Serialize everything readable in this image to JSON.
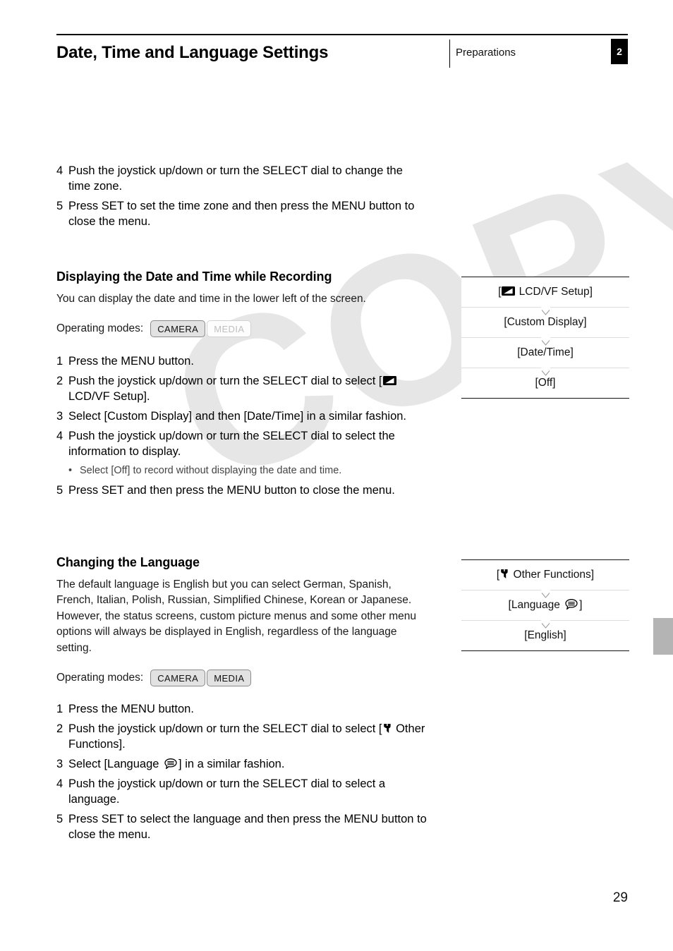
{
  "header": {
    "title": "Date, Time and Language Settings",
    "section": "Preparations",
    "chapter_number": "2"
  },
  "watermark": {
    "text": "COPY"
  },
  "top_steps": [
    {
      "num": "4",
      "text": "Push the joystick up/down or turn the SELECT dial to change the time zone."
    },
    {
      "num": "5",
      "text": "Press SET to set the time zone and then press the MENU button to close the menu."
    }
  ],
  "section_display": {
    "heading": "Displaying the Date and Time while Recording",
    "intro": "You can display the date and time in the lower left of the screen.",
    "operating_modes_label": "Operating modes:",
    "modes": [
      {
        "label": "CAMERA",
        "active": true
      },
      {
        "label": "MEDIA",
        "active": false
      }
    ],
    "steps": [
      {
        "num": "1",
        "text": "Press the MENU button."
      },
      {
        "num": "2",
        "text_before": "Push the joystick up/down or turn the SELECT dial to select [",
        "icon": "lcdvf-icon",
        "text_after": " LCD/VF Setup]."
      },
      {
        "num": "3",
        "text": "Select [Custom Display] and then [Date/Time] in a similar fashion."
      },
      {
        "num": "4",
        "text": "Push the joystick up/down or turn the SELECT dial to select the information to display."
      },
      {
        "num": "5",
        "text": "Press SET and then press the MENU button to close the menu."
      }
    ],
    "bullet": "Select [Off] to record without displaying the date and time.",
    "menu_flow": [
      {
        "prefix": "[",
        "icon": "lcdvf-icon",
        "label": " LCD/VF Setup]"
      },
      {
        "label": "[Custom Display]"
      },
      {
        "label": "[Date/Time]"
      },
      {
        "label": "[Off]"
      }
    ]
  },
  "section_language": {
    "heading": "Changing the Language",
    "intro": "The default language is English but you can select German, Spanish, French, Italian, Polish, Russian, Simplified Chinese, Korean or Japanese. However, the status screens, custom picture menus and some other menu options will always be displayed in English, regardless of the language setting.",
    "operating_modes_label": "Operating modes:",
    "modes": [
      {
        "label": "CAMERA",
        "active": true
      },
      {
        "label": "MEDIA",
        "active": true
      }
    ],
    "steps": [
      {
        "num": "1",
        "text": "Press the MENU button."
      },
      {
        "num": "2",
        "text_before": "Push the joystick up/down or turn the SELECT dial to select [",
        "icon": "wrench-icon",
        "text_after": " Other Functions]."
      },
      {
        "num": "3",
        "text_before": "Select [Language ",
        "icon": "language-icon",
        "text_after": "] in a similar fashion."
      },
      {
        "num": "4",
        "text": "Push the joystick up/down or turn the SELECT dial to select a language."
      },
      {
        "num": "5",
        "text": "Press SET to select the language and then press the MENU button to close the menu."
      }
    ],
    "menu_flow": [
      {
        "prefix": "[",
        "icon": "wrench-icon",
        "label": " Other Functions]"
      },
      {
        "prefix": "[Language ",
        "icon": "language-icon",
        "label": "]"
      },
      {
        "label": "[English]"
      }
    ]
  },
  "footer": {
    "page_number": "29"
  },
  "colors": {
    "text": "#000000",
    "muted_text": "#444444",
    "badge_on_bg": "#e2e2e2",
    "badge_off_text": "#c0c0c0",
    "rule_dark": "#111111",
    "rule_light": "#dddddd",
    "watermark": "#e6e6e6",
    "edge_tab": "#b4b4b4"
  }
}
